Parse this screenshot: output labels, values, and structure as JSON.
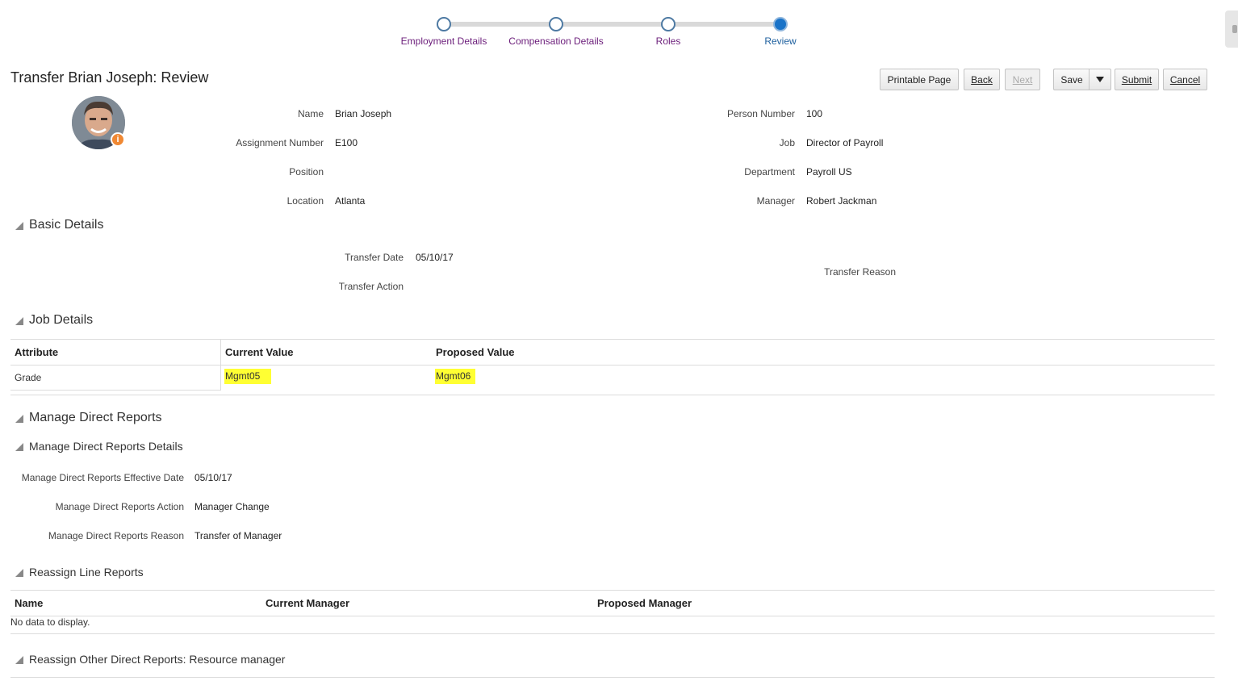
{
  "train": {
    "steps": [
      {
        "label": "Employment Details"
      },
      {
        "label": "Compensation Details"
      },
      {
        "label": "Roles"
      },
      {
        "label": "Review"
      }
    ]
  },
  "page": {
    "title": "Transfer Brian Joseph: Review"
  },
  "toolbar": {
    "printable": "Printable Page",
    "back": "Back",
    "next": "Next",
    "save": "Save",
    "submit": "Submit",
    "cancel": "Cancel"
  },
  "person": {
    "info_badge": "i",
    "name_label": "Name",
    "name": "Brian Joseph",
    "assignment_label": "Assignment Number",
    "assignment": "E100",
    "position_label": "Position",
    "position": "",
    "location_label": "Location",
    "location": "Atlanta",
    "person_number_label": "Person Number",
    "person_number": "100",
    "job_label": "Job",
    "job": "Director of Payroll",
    "department_label": "Department",
    "department": "Payroll US",
    "manager_label": "Manager",
    "manager": "Robert Jackman"
  },
  "basic": {
    "title": "Basic Details",
    "transfer_date_label": "Transfer Date",
    "transfer_date": "05/10/17",
    "transfer_action_label": "Transfer Action",
    "transfer_reason_label": "Transfer Reason"
  },
  "job": {
    "title": "Job Details",
    "columns": [
      "Attribute",
      "Current Value",
      "Proposed Value"
    ],
    "rows": [
      {
        "attribute": "Grade",
        "current": "Mgmt05",
        "proposed": "Mgmt06"
      }
    ],
    "highlight_color": "#ffff33"
  },
  "mdr": {
    "title": "Manage Direct Reports",
    "details_title": "Manage Direct Reports Details",
    "date_label": "Manage Direct Reports Effective Date",
    "date": "05/10/17",
    "action_label": "Manage Direct Reports Action",
    "action": "Manager Change",
    "reason_label": "Manage Direct Reports Reason",
    "reason": "Transfer of Manager"
  },
  "reassign_line": {
    "title": "Reassign Line Reports",
    "columns": [
      "Name",
      "Current Manager",
      "Proposed Manager"
    ],
    "empty": "No data to display."
  },
  "reassign_other": {
    "title": "Reassign Other Direct Reports: Resource manager"
  }
}
